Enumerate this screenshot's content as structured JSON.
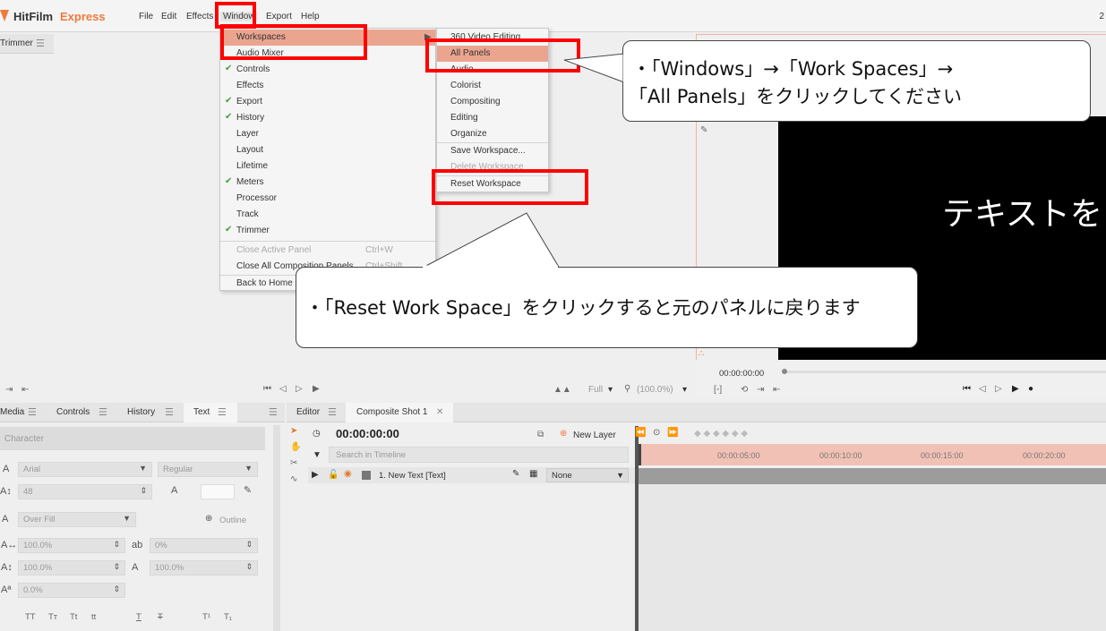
{
  "app": {
    "logo_main": "HitFilm",
    "logo_accent": "Express"
  },
  "menubar": [
    {
      "label": "File"
    },
    {
      "label": "Edit"
    },
    {
      "label": "Effects"
    },
    {
      "label": "Window"
    },
    {
      "label": "Export"
    },
    {
      "label": "Help"
    }
  ],
  "window_controls": "2",
  "panels": {
    "trimmer_tab": "Trimmer",
    "viewer": {
      "text": "テキストを",
      "timecode": "00:00:00:00"
    },
    "trimmer_toolbar": {
      "quality": "Full",
      "zoom": "(100.0%)"
    },
    "left_tabs": [
      "Media",
      "Controls",
      "History",
      "Text"
    ],
    "character": {
      "section": "Character",
      "font": "Arial",
      "style": "Regular",
      "size": "48",
      "fill_mode": "Over Fill",
      "outline": "Outline",
      "scale_h": "100.0%",
      "tracking": "0%",
      "scale_v": "100.0%",
      "kerning": "100.0%",
      "baseline": "0.0%",
      "text_styles": [
        "TT",
        "Tт",
        "Tt",
        "tt",
        "T",
        "T",
        "T¹",
        "T₁"
      ]
    }
  },
  "editor": {
    "tabs": [
      "Editor",
      "Composite Shot 1"
    ],
    "timecode": "00:00:00:00",
    "new_layer": "New Layer",
    "search_placeholder": "Search in Timeline",
    "layer": {
      "name": "1. New Text [Text]",
      "blend": "None"
    },
    "ruler": [
      "00:00:05:00",
      "00:00:10:00",
      "00:00:15:00",
      "00:00:20:00"
    ]
  },
  "window_menu": {
    "items": [
      {
        "label": "Workspaces",
        "checked": false,
        "highlighted": true,
        "submenu": true
      },
      {
        "label": "Audio Mixer",
        "checked": false
      },
      {
        "label": "Controls",
        "checked": true
      },
      {
        "label": "Effects",
        "checked": false
      },
      {
        "label": "Export",
        "checked": true
      },
      {
        "label": "History",
        "checked": true
      },
      {
        "label": "Layer",
        "checked": false
      },
      {
        "label": "Layout",
        "checked": false
      },
      {
        "label": "Lifetime",
        "checked": false
      },
      {
        "label": "Meters",
        "checked": true
      },
      {
        "label": "Processor",
        "checked": false
      },
      {
        "label": "Track",
        "checked": false
      },
      {
        "label": "Trimmer",
        "checked": true
      }
    ],
    "close_active": {
      "label": "Close Active Panel",
      "shortcut": "Ctrl+W"
    },
    "close_all": {
      "label": "Close All Composition Panels",
      "shortcut": "Ctrl+Shift"
    },
    "back_home": "Back to Home"
  },
  "workspaces_menu": {
    "items": [
      "360 Video Editing",
      "All Panels",
      "Audio",
      "Colorist",
      "Compositing",
      "Editing",
      "Organize"
    ],
    "save": "Save Workspace...",
    "delete": "Delete Workspace",
    "reset": "Reset Workspace"
  },
  "callouts": {
    "top_line1": "・「Windows」→「Work Spaces」→",
    "top_line2": "「All Panels」をクリックしてください",
    "bottom": "・「Reset Work Space」をクリックすると元のパネルに戻ります"
  },
  "colors": {
    "accent": "#f07a3c",
    "highlight": "#eba58f",
    "annotation": "#ff0000",
    "check": "#3aa63a"
  }
}
